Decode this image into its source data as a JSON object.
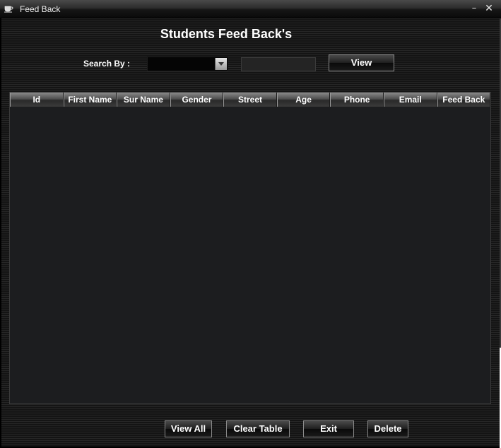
{
  "window": {
    "title": "Feed Back",
    "icon": "coffee-cup-icon",
    "minimize_glyph": "–",
    "close_glyph": "✕"
  },
  "heading": "Students Feed Back's",
  "search": {
    "label": "Search By :",
    "combo_value": "",
    "text_value": "",
    "view_button": "View"
  },
  "table": {
    "columns": [
      "Id",
      "First Name",
      "Sur Name",
      "Gender",
      "Street",
      "Age",
      "Phone",
      "Email",
      "Feed Back"
    ],
    "rows": []
  },
  "buttons": {
    "view_all": "View All",
    "clear_table": "Clear Table",
    "exit": "Exit",
    "delete": "Delete"
  }
}
